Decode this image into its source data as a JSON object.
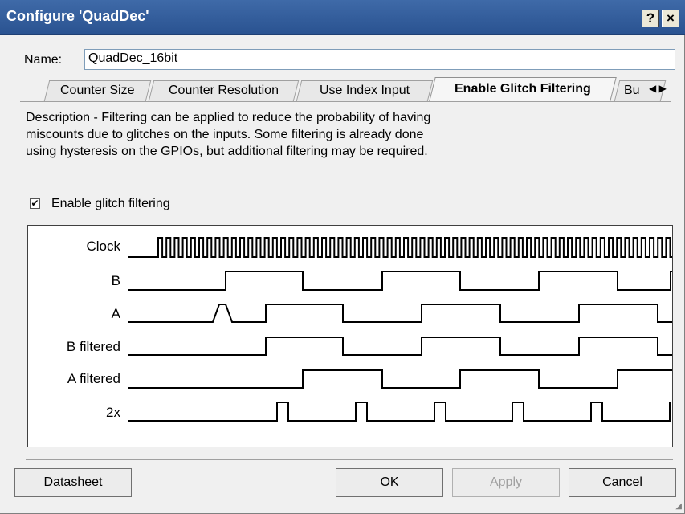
{
  "window": {
    "title": "Configure 'QuadDec'",
    "help": "?",
    "close": "×"
  },
  "name": {
    "label": "Name:",
    "value": "QuadDec_16bit"
  },
  "tabs": [
    {
      "label": "Counter Size"
    },
    {
      "label": "Counter Resolution"
    },
    {
      "label": "Use Index Input"
    },
    {
      "label": "Enable Glitch Filtering",
      "active": true
    },
    {
      "label": "Bu"
    }
  ],
  "tab_scroll": {
    "left": "◀",
    "right": "▶"
  },
  "description": {
    "line1": "Description - Filtering can be applied to reduce the probability of having",
    "line2": "miscounts due to glitches on the inputs. Some filtering is already done",
    "line3": "using hysteresis on the GPIOs, but additional filtering may be required."
  },
  "glitch": {
    "label": "Enable glitch filtering",
    "checked": true,
    "check_glyph": "✔"
  },
  "signals": [
    {
      "label": "Clock"
    },
    {
      "label": "B"
    },
    {
      "label": "A"
    },
    {
      "label": "B filtered"
    },
    {
      "label": "A filtered"
    },
    {
      "label": "2x"
    }
  ],
  "buttons": {
    "datasheet": "Datasheet",
    "ok": "OK",
    "apply": "Apply",
    "cancel": "Cancel"
  }
}
